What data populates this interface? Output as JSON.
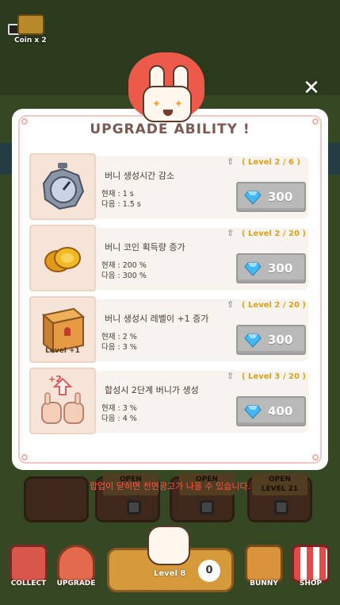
{
  "coin_badge": {
    "label": "Coin x 2"
  },
  "background": {
    "open_slots": [
      {
        "line1": "OPEN",
        "line2": ""
      },
      {
        "line1": "OPEN",
        "line2": ""
      },
      {
        "line1": "OPEN",
        "line2": "LEVEL 21"
      }
    ]
  },
  "modal": {
    "title": "UPGRADE ABILITY !",
    "close_icon": "close-icon",
    "rows": [
      {
        "icon": "stopwatch-icon",
        "name": "버니 생성시간 감소",
        "current": "현재 : 1 s",
        "next": "다음 : 1.5 s",
        "level": "( Level 2 / 6 )",
        "price": "300"
      },
      {
        "icon": "gold-coin-icon",
        "name": "버니 코인 획득량 증가",
        "current": "현재 : 200 %",
        "next": "다음 : 300 %",
        "level": "( Level 2 / 20 )",
        "price": "300"
      },
      {
        "icon": "level-box-icon",
        "icon_text": "Level +1",
        "name": "버니 생성시 레벨이 +1 증가",
        "current": "현재 : 2 %",
        "next": "다음 : 3 %",
        "level": "( Level 2 / 20 )",
        "price": "300"
      },
      {
        "icon": "merge-bunnies-icon",
        "icon_text": "+2",
        "name": "합성시 2단계 버니가 생성",
        "current": "현재 : 3 %",
        "next": "다음 : 4 %",
        "level": "( Level 3 / 20 )",
        "price": "400"
      }
    ],
    "price_icon": "diamond-icon"
  },
  "warning": "팝업이 닫히면 전면광고가 나올 수 있습니다.",
  "bottom_bar": {
    "collect": "COLLECT",
    "upgrade": "UPGRADE",
    "center_level": "Level 8",
    "center_count": "0",
    "bunny": "BUNNY",
    "shop": "SHOP"
  },
  "colors": {
    "panel": "#ffffff",
    "title": "#7a5a52",
    "level_text": "#d8a21e",
    "buy_button": "#b9b9b9",
    "diamond": "#46b8f0",
    "warning": "#ff5544",
    "mascot_flame": "#ee5a4a"
  }
}
